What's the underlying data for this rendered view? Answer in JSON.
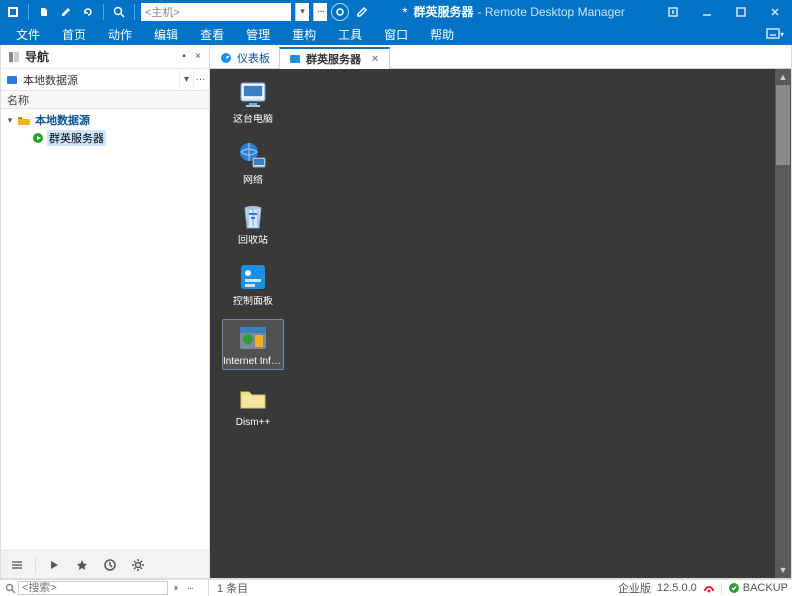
{
  "titlebar": {
    "host_placeholder": "<主机>",
    "modified_indicator": "*",
    "doc_name": "群英服务器",
    "app_name": "- Remote Desktop Manager"
  },
  "menu": {
    "items": [
      "文件",
      "首页",
      "动作",
      "编辑",
      "查看",
      "管理",
      "重构",
      "工具",
      "窗口",
      "帮助"
    ]
  },
  "nav": {
    "title": "导航",
    "datasource": "本地数据源",
    "column_header": "名称",
    "tree": {
      "root_label": "本地数据源",
      "child_label": "群英服务器"
    }
  },
  "tabs": {
    "items": [
      {
        "label": "仪表板",
        "active": false
      },
      {
        "label": "群英服务器",
        "active": true
      }
    ]
  },
  "desktop": {
    "icons": [
      {
        "key": "this-pc",
        "label": "这台电脑"
      },
      {
        "key": "network",
        "label": "网络"
      },
      {
        "key": "recycle",
        "label": "回收站"
      },
      {
        "key": "control-panel",
        "label": "控制面板"
      },
      {
        "key": "iis",
        "label": "Internet Informatio...",
        "selected": true
      },
      {
        "key": "dism",
        "label": "Dism++"
      }
    ]
  },
  "status": {
    "search_placeholder": "<搜索>",
    "count": "1 条目",
    "edition": "企业版",
    "version": "12.5.0.0",
    "backup": "BACKUP"
  }
}
